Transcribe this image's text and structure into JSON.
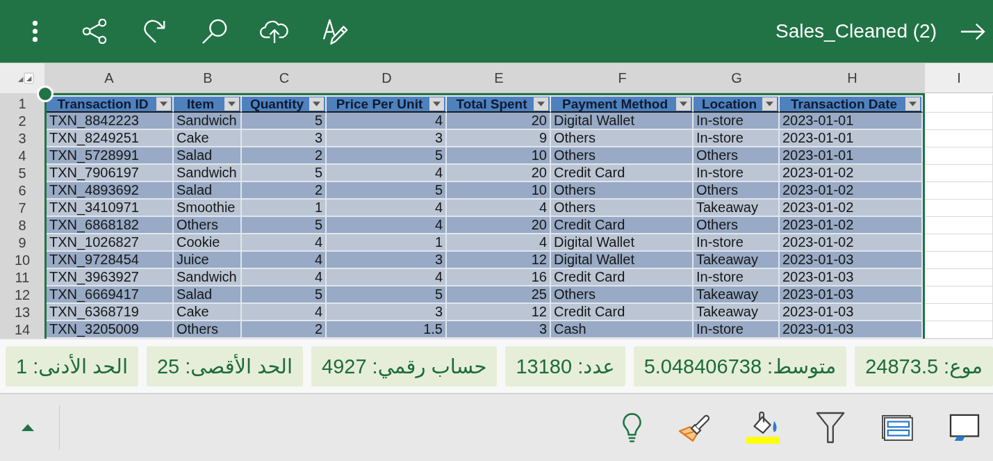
{
  "toolbar": {
    "title": "Sales_Cleaned (2)"
  },
  "sheet": {
    "columns": [
      {
        "letter": "A",
        "selected": true
      },
      {
        "letter": "B",
        "selected": true
      },
      {
        "letter": "C",
        "selected": true
      },
      {
        "letter": "D",
        "selected": true
      },
      {
        "letter": "E",
        "selected": true
      },
      {
        "letter": "F",
        "selected": true
      },
      {
        "letter": "G",
        "selected": true
      },
      {
        "letter": "H",
        "selected": true
      },
      {
        "letter": "I",
        "selected": false
      }
    ],
    "row_numbers": [
      {
        "label": "1",
        "selected": true
      },
      {
        "label": "2",
        "selected": true
      },
      {
        "label": "3",
        "selected": true
      },
      {
        "label": "4",
        "selected": true
      },
      {
        "label": "5",
        "selected": true
      },
      {
        "label": "6",
        "selected": true
      },
      {
        "label": "7",
        "selected": true
      },
      {
        "label": "8",
        "selected": true
      },
      {
        "label": "9",
        "selected": true
      },
      {
        "label": "10",
        "selected": true
      },
      {
        "label": "11",
        "selected": true
      },
      {
        "label": "12",
        "selected": true
      },
      {
        "label": "13",
        "selected": true
      },
      {
        "label": "14",
        "selected": true
      }
    ]
  },
  "table": {
    "columns": [
      {
        "name": "Transaction ID",
        "kind": "text"
      },
      {
        "name": "Item",
        "kind": "text"
      },
      {
        "name": "Quantity",
        "kind": "number"
      },
      {
        "name": "Price Per Unit",
        "kind": "number"
      },
      {
        "name": "Total Spent",
        "kind": "number"
      },
      {
        "name": "Payment Method",
        "kind": "text"
      },
      {
        "name": "Location",
        "kind": "text"
      },
      {
        "name": "Transaction Date",
        "kind": "text"
      }
    ],
    "rows": [
      [
        "TXN_8842223",
        "Sandwich",
        "5",
        "4",
        "20",
        "Digital Wallet",
        "In-store",
        "2023-01-01"
      ],
      [
        "TXN_8249251",
        "Cake",
        "3",
        "3",
        "9",
        "Others",
        "In-store",
        "2023-01-01"
      ],
      [
        "TXN_5728991",
        "Salad",
        "2",
        "5",
        "10",
        "Others",
        "Others",
        "2023-01-01"
      ],
      [
        "TXN_7906197",
        "Sandwich",
        "5",
        "4",
        "20",
        "Credit Card",
        "In-store",
        "2023-01-02"
      ],
      [
        "TXN_4893692",
        "Salad",
        "2",
        "5",
        "10",
        "Others",
        "Others",
        "2023-01-02"
      ],
      [
        "TXN_3410971",
        "Smoothie",
        "1",
        "4",
        "4",
        "Others",
        "Takeaway",
        "2023-01-02"
      ],
      [
        "TXN_6868182",
        "Others",
        "5",
        "4",
        "20",
        "Credit Card",
        "Others",
        "2023-01-02"
      ],
      [
        "TXN_1026827",
        "Cookie",
        "4",
        "1",
        "4",
        "Digital Wallet",
        "In-store",
        "2023-01-02"
      ],
      [
        "TXN_9728454",
        "Juice",
        "4",
        "3",
        "12",
        "Digital Wallet",
        "Takeaway",
        "2023-01-03"
      ],
      [
        "TXN_3963927",
        "Sandwich",
        "4",
        "4",
        "16",
        "Credit Card",
        "In-store",
        "2023-01-03"
      ],
      [
        "TXN_6669417",
        "Salad",
        "5",
        "5",
        "25",
        "Others",
        "Takeaway",
        "2023-01-03"
      ],
      [
        "TXN_6368719",
        "Cake",
        "4",
        "3",
        "12",
        "Credit Card",
        "Takeaway",
        "2023-01-03"
      ],
      [
        "TXN_3205009",
        "Others",
        "2",
        "1.5",
        "3",
        "Cash",
        "In-store",
        "2023-01-03"
      ]
    ]
  },
  "status_bar": {
    "items": [
      "موع: 24873.5",
      "متوسط: 5.048406738",
      "عدد: 13180",
      "حساب رقمي: 4927",
      "الحد الأقصى: 25",
      "الحد الأدنى: 1"
    ]
  }
}
